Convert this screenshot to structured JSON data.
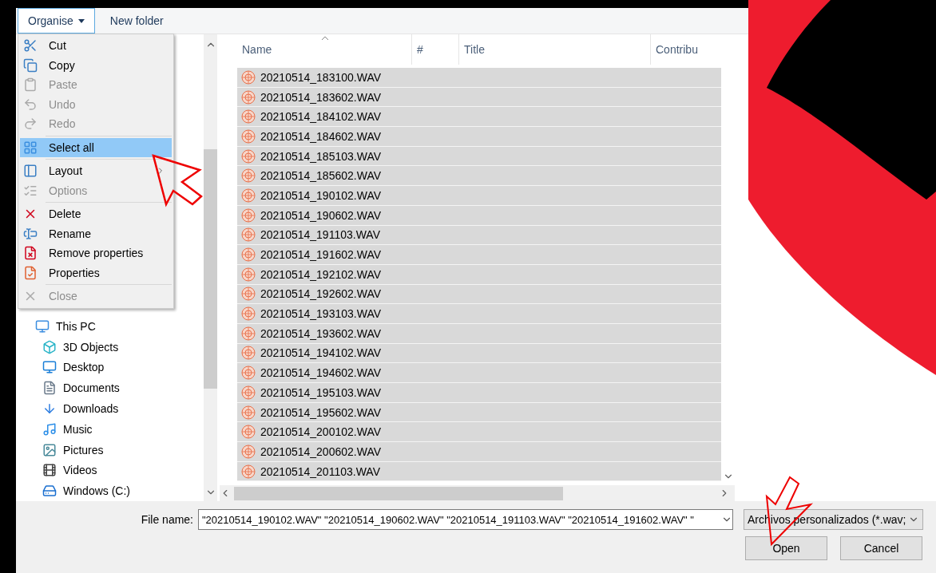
{
  "toolbar": {
    "buttons": [
      {
        "label": "Organise",
        "selected": true,
        "dropdown": true
      },
      {
        "label": "New folder",
        "selected": false,
        "dropdown": false
      }
    ]
  },
  "organise_menu": {
    "groups": [
      [
        {
          "label": "Cut",
          "disabled": false,
          "selected": false
        },
        {
          "label": "Copy",
          "disabled": false,
          "selected": false
        },
        {
          "label": "Paste",
          "disabled": true,
          "selected": false
        },
        {
          "label": "Undo",
          "disabled": true,
          "selected": false
        },
        {
          "label": "Redo",
          "disabled": true,
          "selected": false
        }
      ],
      [
        {
          "label": "Select all",
          "disabled": false,
          "selected": true
        }
      ],
      [
        {
          "label": "Layout",
          "disabled": false,
          "selected": false,
          "submenu": true
        },
        {
          "label": "Options",
          "disabled": true,
          "selected": false
        }
      ],
      [
        {
          "label": "Delete",
          "disabled": false,
          "selected": false
        },
        {
          "label": "Rename",
          "disabled": false,
          "selected": false
        },
        {
          "label": "Remove properties",
          "disabled": false,
          "selected": false
        },
        {
          "label": "Properties",
          "disabled": false,
          "selected": false
        }
      ],
      [
        {
          "label": "Close",
          "disabled": true,
          "selected": false
        }
      ]
    ]
  },
  "navigation": {
    "items": [
      {
        "label": "This PC",
        "children": [
          {
            "label": "3D Objects"
          },
          {
            "label": "Desktop"
          },
          {
            "label": "Documents"
          },
          {
            "label": "Downloads"
          },
          {
            "label": "Music"
          },
          {
            "label": "Pictures"
          },
          {
            "label": "Videos"
          },
          {
            "label": "Windows (C:)"
          }
        ]
      }
    ]
  },
  "file_list": {
    "columns": [
      {
        "label": "Name",
        "sorted": true
      },
      {
        "label": "#",
        "sorted": false
      },
      {
        "label": "Title",
        "sorted": false
      },
      {
        "label": "Contribu",
        "sorted": false
      }
    ],
    "rows": [
      {
        "name": "20210514_183100.WAV",
        "selected": true
      },
      {
        "name": "20210514_183602.WAV",
        "selected": true
      },
      {
        "name": "20210514_184102.WAV",
        "selected": true
      },
      {
        "name": "20210514_184602.WAV",
        "selected": true
      },
      {
        "name": "20210514_185103.WAV",
        "selected": true
      },
      {
        "name": "20210514_185602.WAV",
        "selected": true
      },
      {
        "name": "20210514_190102.WAV",
        "selected": true
      },
      {
        "name": "20210514_190602.WAV",
        "selected": true
      },
      {
        "name": "20210514_191103.WAV",
        "selected": true
      },
      {
        "name": "20210514_191602.WAV",
        "selected": true
      },
      {
        "name": "20210514_192102.WAV",
        "selected": true
      },
      {
        "name": "20210514_192602.WAV",
        "selected": true
      },
      {
        "name": "20210514_193103.WAV",
        "selected": true
      },
      {
        "name": "20210514_193602.WAV",
        "selected": true
      },
      {
        "name": "20210514_194102.WAV",
        "selected": true
      },
      {
        "name": "20210514_194602.WAV",
        "selected": true
      },
      {
        "name": "20210514_195103.WAV",
        "selected": true
      },
      {
        "name": "20210514_195602.WAV",
        "selected": true
      },
      {
        "name": "20210514_200102.WAV",
        "selected": true
      },
      {
        "name": "20210514_200602.WAV",
        "selected": true
      },
      {
        "name": "20210514_201103.WAV",
        "selected": true
      }
    ]
  },
  "footer": {
    "file_name_label": "File name:",
    "file_name": "\"20210514_190102.WAV\" \"20210514_190602.WAV\" \"20210514_191103.WAV\" \"20210514_191602.WAV\" \"",
    "file_type": "Archivos personalizados (*.wav;",
    "buttons": [
      {
        "label": "Open"
      },
      {
        "label": "Cancel"
      }
    ]
  }
}
